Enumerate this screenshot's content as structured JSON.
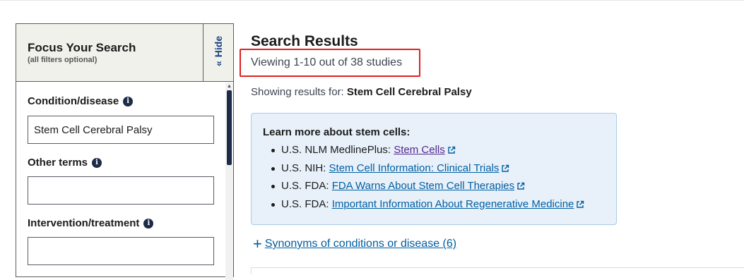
{
  "sidebar": {
    "title": "Focus Your Search",
    "subtitle": "(all filters optional)",
    "hide_label": "Hide",
    "fields": [
      {
        "label": "Condition/disease",
        "value": "Stem Cell Cerebral Palsy",
        "placeholder": ""
      },
      {
        "label": "Other terms",
        "value": "",
        "placeholder": ""
      },
      {
        "label": "Intervention/treatment",
        "value": "",
        "placeholder": ""
      }
    ]
  },
  "main": {
    "title": "Search Results",
    "viewing": "Viewing 1-10 out of 38 studies",
    "showing_prefix": "Showing results for:",
    "showing_query": "Stem Cell Cerebral Palsy",
    "info": {
      "title": "Learn more about stem cells:",
      "items": [
        {
          "source": "U.S. NLM MedlinePlus:",
          "link": "Stem Cells"
        },
        {
          "source": "U.S. NIH:",
          "link": "Stem Cell Information: Clinical Trials"
        },
        {
          "source": "U.S. FDA:",
          "link": "FDA Warns About Stem Cell Therapies"
        },
        {
          "source": "U.S. FDA:",
          "link": "Important Information About Regenerative Medicine"
        }
      ]
    },
    "synonyms_link": "Synonyms of conditions or disease (6)"
  },
  "colors": {
    "link": "#005ea2",
    "visited_link": "#54278f",
    "highlight_box": "#e02020",
    "info_bg": "#e8f1fa",
    "sidebar_header_bg": "#f1f1ec"
  }
}
